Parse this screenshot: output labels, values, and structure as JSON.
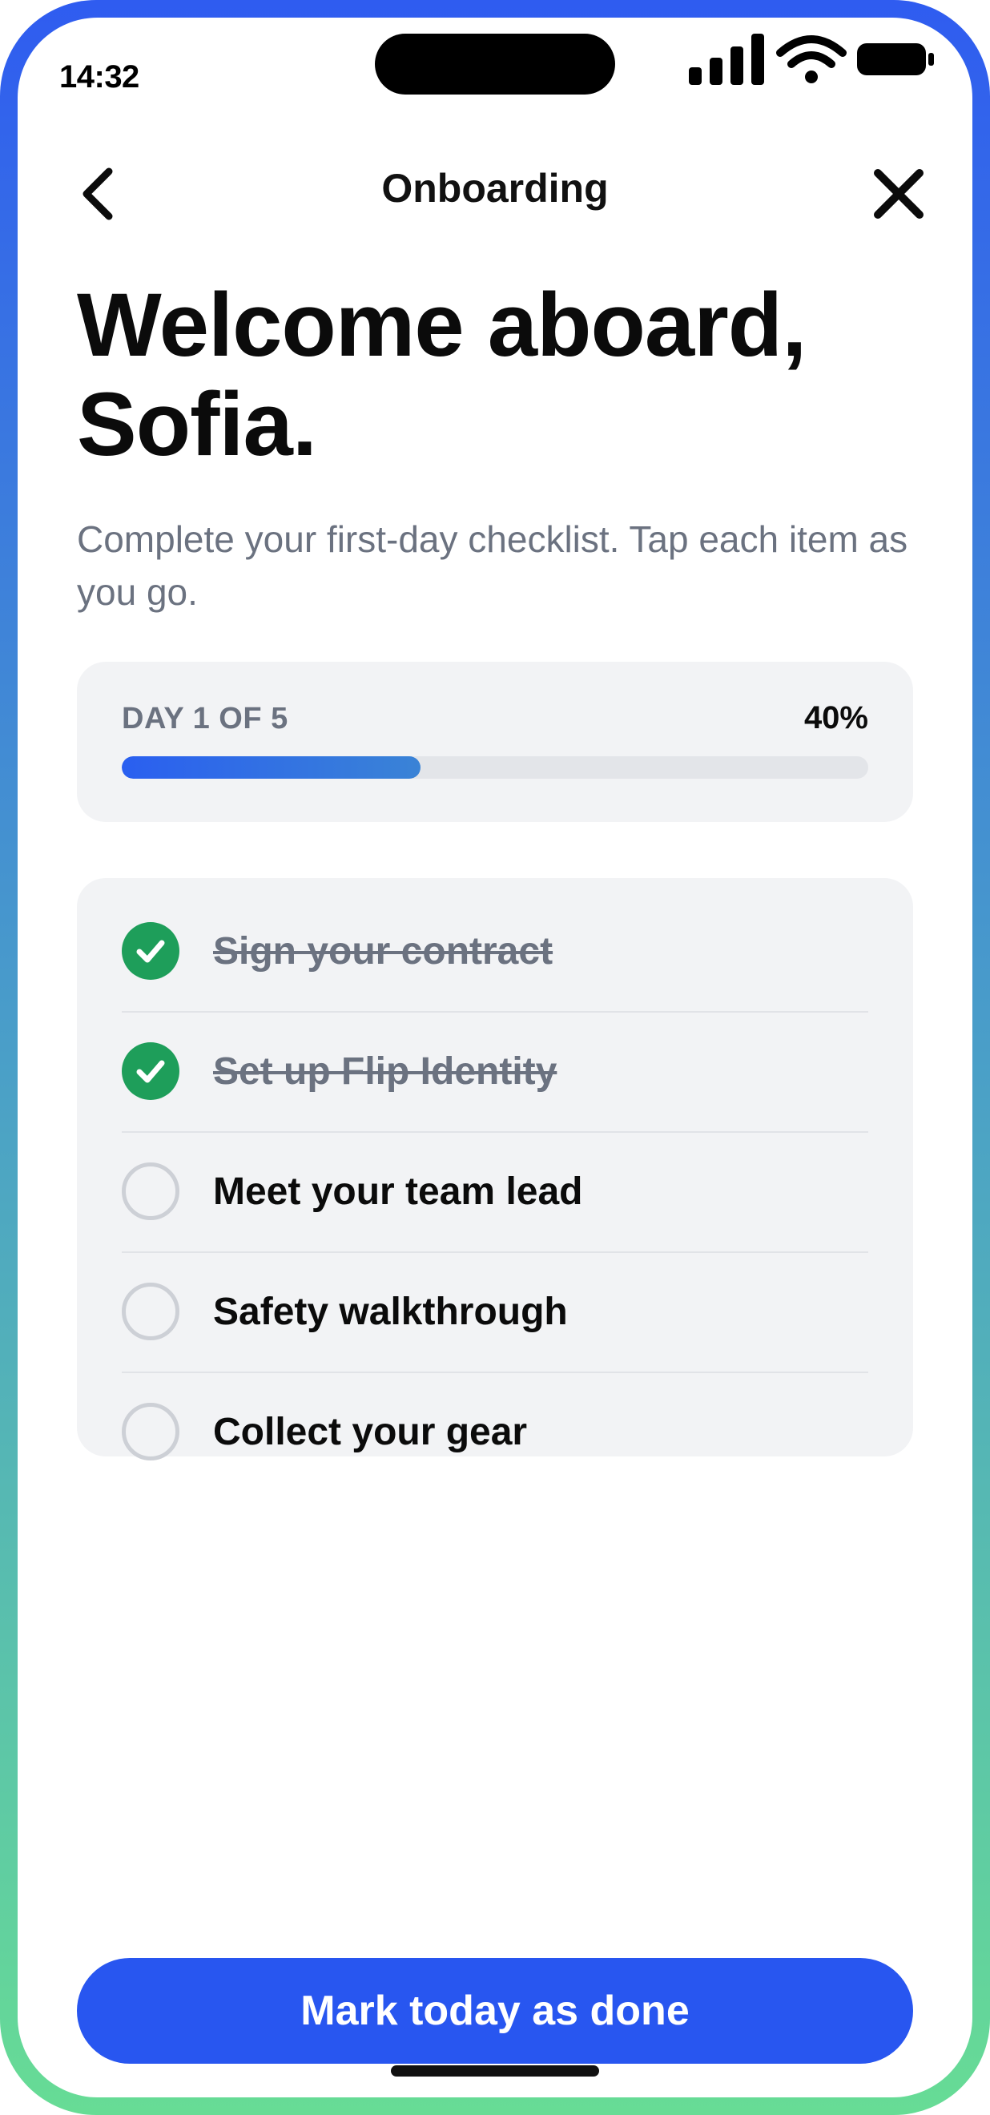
{
  "status_bar": {
    "time": "14:32",
    "icons": [
      "signal-icon",
      "wifi-icon",
      "battery-icon"
    ]
  },
  "nav": {
    "title": "Onboarding",
    "back_icon": "chevron-left-icon",
    "close_icon": "close-icon"
  },
  "heading": "Welcome aboard, Sofia.",
  "subtitle": "Complete your first-day checklist. Tap each item as you go.",
  "progress": {
    "day_label": "DAY 1 OF 5",
    "percent_label": "40%",
    "percent_value": 40
  },
  "checklist": {
    "items": [
      {
        "label": "Sign your contract",
        "done": true
      },
      {
        "label": "Set up Flip Identity",
        "done": true
      },
      {
        "label": "Meet your team lead",
        "done": false
      },
      {
        "label": "Safety walkthrough",
        "done": false
      },
      {
        "label": "Collect your gear",
        "done": false
      }
    ]
  },
  "cta_label": "Mark today as done",
  "colors": {
    "accent": "#2856f0",
    "done_green": "#1e9e5a",
    "muted_text": "#6b7280",
    "card_bg": "#f2f3f5"
  }
}
